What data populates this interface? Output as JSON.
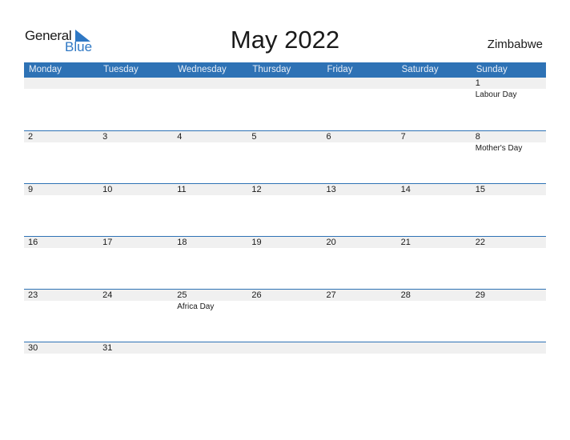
{
  "logo": {
    "word1": "General",
    "word2": "Blue",
    "accent": "#2f78c4"
  },
  "header": {
    "title": "May 2022",
    "country": "Zimbabwe"
  },
  "colors": {
    "header_bg": "#2e72b5",
    "date_row_bg": "#f0f0f0"
  },
  "weekdays": [
    "Monday",
    "Tuesday",
    "Wednesday",
    "Thursday",
    "Friday",
    "Saturday",
    "Sunday"
  ],
  "weeks": [
    [
      {
        "d": ""
      },
      {
        "d": ""
      },
      {
        "d": ""
      },
      {
        "d": ""
      },
      {
        "d": ""
      },
      {
        "d": ""
      },
      {
        "d": "1",
        "ev": "Labour Day"
      }
    ],
    [
      {
        "d": "2"
      },
      {
        "d": "3"
      },
      {
        "d": "4"
      },
      {
        "d": "5"
      },
      {
        "d": "6"
      },
      {
        "d": "7"
      },
      {
        "d": "8",
        "ev": "Mother's Day"
      }
    ],
    [
      {
        "d": "9"
      },
      {
        "d": "10"
      },
      {
        "d": "11"
      },
      {
        "d": "12"
      },
      {
        "d": "13"
      },
      {
        "d": "14"
      },
      {
        "d": "15"
      }
    ],
    [
      {
        "d": "16"
      },
      {
        "d": "17"
      },
      {
        "d": "18"
      },
      {
        "d": "19"
      },
      {
        "d": "20"
      },
      {
        "d": "21"
      },
      {
        "d": "22"
      }
    ],
    [
      {
        "d": "23"
      },
      {
        "d": "24"
      },
      {
        "d": "25",
        "ev": "Africa Day"
      },
      {
        "d": "26"
      },
      {
        "d": "27"
      },
      {
        "d": "28"
      },
      {
        "d": "29"
      }
    ],
    [
      {
        "d": "30"
      },
      {
        "d": "31"
      },
      {
        "d": ""
      },
      {
        "d": ""
      },
      {
        "d": ""
      },
      {
        "d": ""
      },
      {
        "d": ""
      }
    ]
  ]
}
